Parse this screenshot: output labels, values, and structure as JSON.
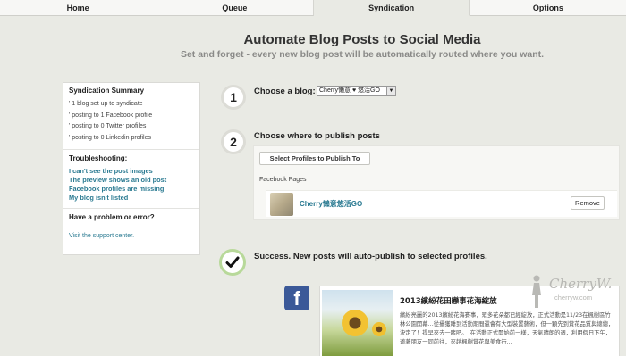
{
  "tabs": [
    {
      "label": "Home"
    },
    {
      "label": "Queue"
    },
    {
      "label": "Syndication"
    },
    {
      "label": "Options"
    }
  ],
  "active_tab": "Syndication",
  "header": {
    "title": "Automate Blog Posts to Social Media",
    "subtitle": "Set and forget - every new blog post will be automatically routed where you want."
  },
  "sidebar": {
    "summary_title": "Syndication Summary",
    "summary_items": [
      "' 1 blog set up to syndicate",
      "' posting to 1 Facebook profile",
      "' posting to 0 Twitter profiles",
      "' posting to 0 Linkedin profiles"
    ],
    "troubleshooting_title": "Troubleshooting:",
    "troubleshooting_links": [
      "I can't see the post images",
      "The preview shows an old post",
      "Facebook profiles are missing",
      "My blog isn't listed"
    ],
    "problem_title": "Have a problem or error?",
    "support_link": "Visit the support center."
  },
  "steps": {
    "step1": {
      "number": "1",
      "label": "Choose a blog:",
      "selected_blog": "Cherry懶意 ♥ 悠活GO"
    },
    "step2": {
      "number": "2",
      "label": "Choose where to publish posts",
      "select_button": "Select Profiles to Publish To",
      "section_label": "Facebook Pages"
    },
    "step3": {
      "label": "Success. New posts will auto-publish to selected profiles."
    }
  },
  "profile": {
    "name": "Cherry懶意悠活GO",
    "remove_label": "Remove"
  },
  "post_preview": {
    "title": "2013繽紛花田戀事花海綻放",
    "body": "繽紛亮麗的2013繽紛花海賽事，眾多花朵都已經綻放，正式活動是11/23在楓樹區竹林公園開幕…從攝獲睡到活動期間還會有大型裝置藝術，但一顆先到賞花品質與總總，決定了！提早來去一睹吧。　在活動正式開始前一樣，天氣晴朗的週，利用假日下午，邀著朋友一同前往，來趟楓樹賞花與美食行..."
  },
  "watermark": {
    "name": "CherryW.",
    "url": "cherryw.com"
  },
  "icons": {
    "check": "check-icon",
    "facebook": "facebook-icon",
    "select_arrow": "dropdown-arrow-icon"
  },
  "colors": {
    "background": "#e9eae4",
    "link": "#2a7a91",
    "facebook": "#3b5998",
    "success_ring": "#b8d99a"
  }
}
